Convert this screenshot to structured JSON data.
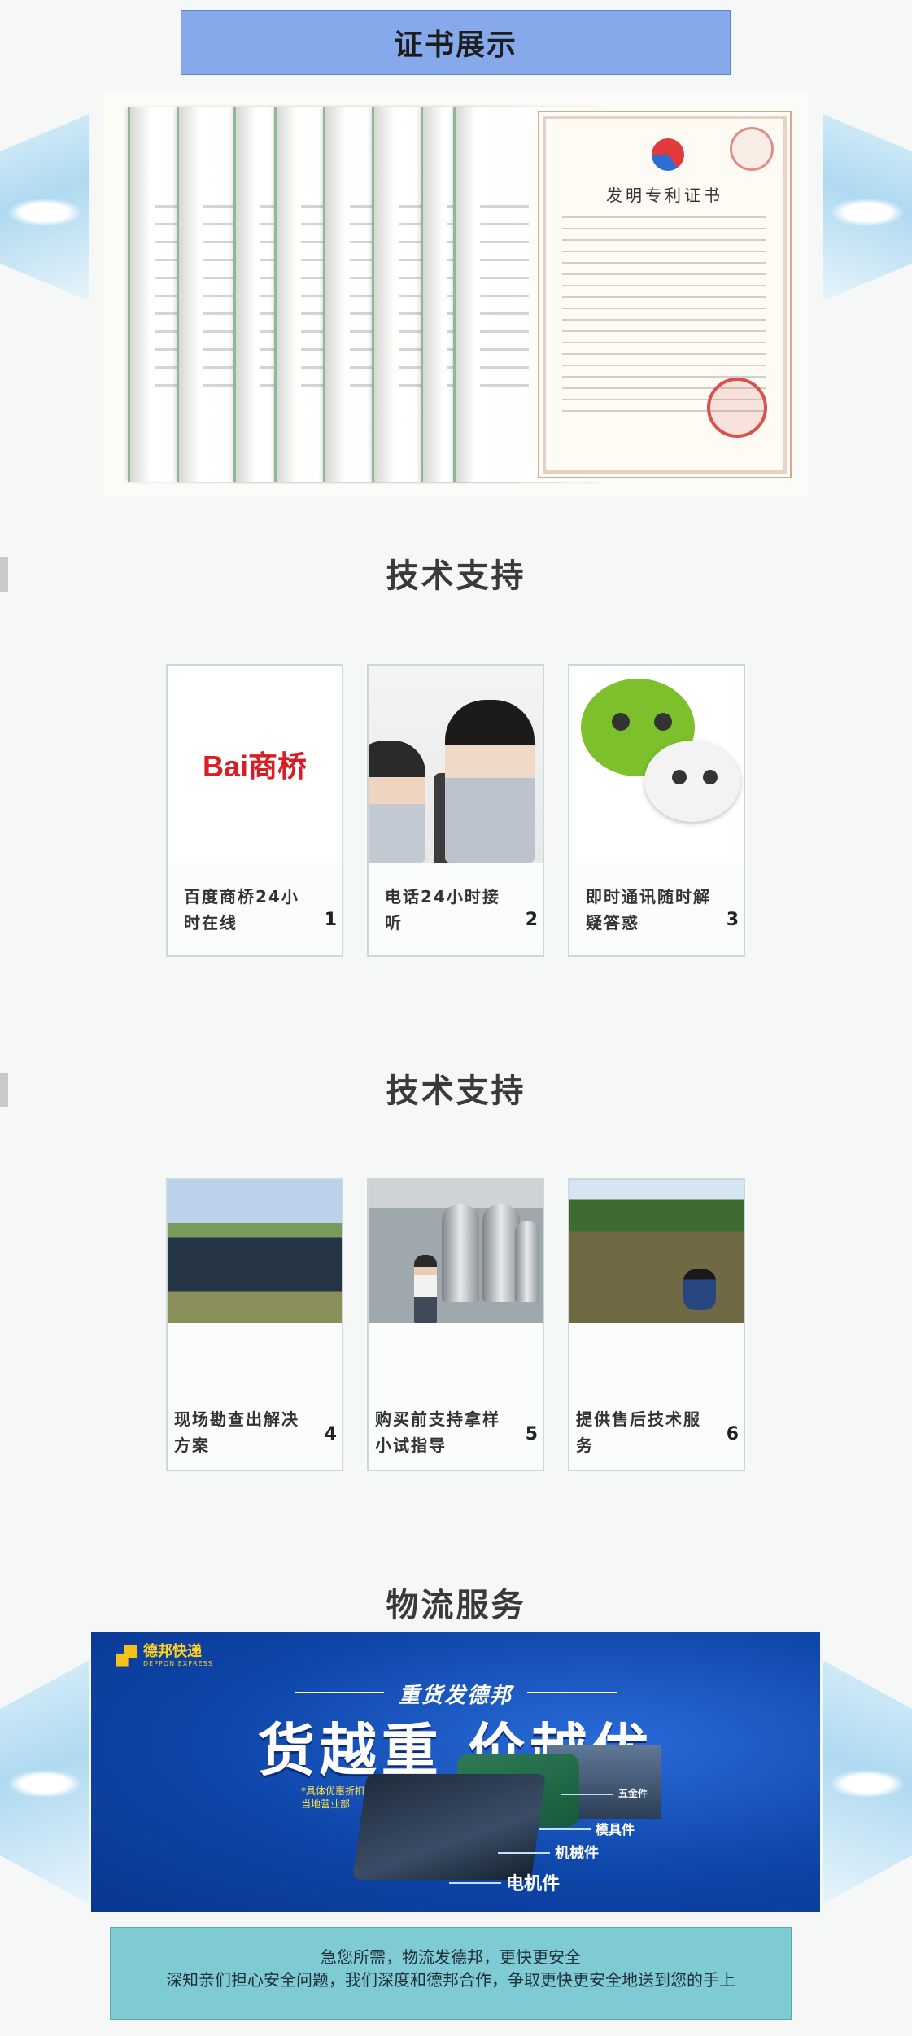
{
  "sections": {
    "certificates_title": "证书展示",
    "tech_support_title_1": "技术支持",
    "tech_support_title_2": "技术支持",
    "logistics_title": "物流服务"
  },
  "certificate": {
    "heading": "发明专利证书"
  },
  "support_cards": [
    {
      "caption": "百度商桥24小时在线",
      "number": "1",
      "image": "baidu-shangqiao-logo",
      "logo_text": "Bai商桥"
    },
    {
      "caption": "电话24小时接听",
      "number": "2",
      "image": "call-center-operators"
    },
    {
      "caption": "即时通讯随时解疑答惑",
      "number": "3",
      "image": "wechat-logo"
    }
  ],
  "service_cards": [
    {
      "caption": "现场勘查出解决方案",
      "number": "4",
      "image": "river-site"
    },
    {
      "caption": "购买前支持拿样小试指导",
      "number": "5",
      "image": "factory-tanks"
    },
    {
      "caption": "提供售后技术服务",
      "number": "6",
      "image": "pond-inspection"
    }
  ],
  "logistics_banner": {
    "brand_name": "德邦快递",
    "brand_sub": "DEPPON EXPRESS",
    "subheading": "重货发德邦",
    "headline": "货越重 价越优",
    "tagline_1": "*具体优惠折扣请咨询",
    "tagline_2": "当地营业部",
    "callouts": [
      "五金件",
      "模具件",
      "机械件",
      "电机件"
    ],
    "accent_color": "#0d45a8"
  },
  "notice": {
    "line_1": "急您所需，物流发德邦，更快更安全",
    "line_2": "深知亲们担心安全问题，我们深度和德邦合作，争取更快更安全地送到您的手上"
  },
  "colors": {
    "title_bar": "#86a9ec",
    "notice_bg": "#7fcbd4"
  }
}
